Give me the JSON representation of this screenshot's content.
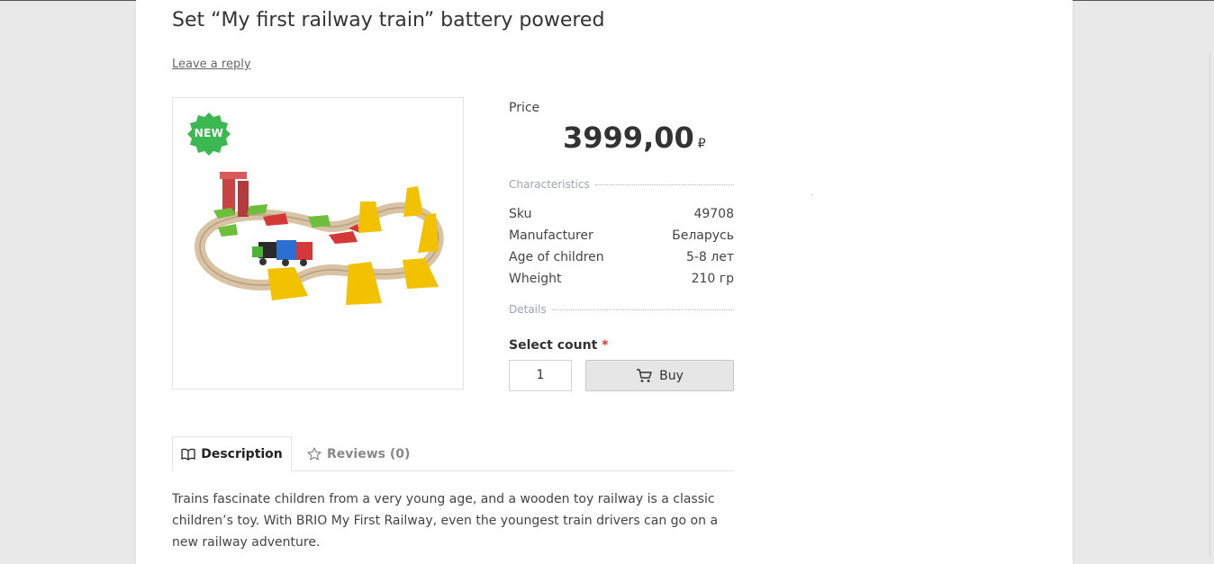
{
  "product": {
    "title": "Set “My first railway train” battery powered",
    "leave_reply": "Leave a reply",
    "badge": "NEW"
  },
  "price": {
    "label": "Price",
    "value": "3999,00",
    "currency": "₽"
  },
  "characteristics": {
    "heading": "Characteristics",
    "rows": [
      {
        "name": "Sku",
        "value": "49708"
      },
      {
        "name": "Manufacturer",
        "value": "Беларусь"
      },
      {
        "name": "Age of children",
        "value": "5-8 лет"
      },
      {
        "name": "Wheight",
        "value": "210 гр"
      }
    ],
    "details_heading": "Details"
  },
  "purchase": {
    "count_label": "Select count",
    "required_mark": "*",
    "quantity": "1",
    "buy_label": "Buy"
  },
  "tabs": [
    {
      "label": "Description",
      "icon": "book-icon",
      "active": true
    },
    {
      "label": "Reviews (0)",
      "icon": "star-icon",
      "active": false
    }
  ],
  "description": "Trains fascinate children from a very young age, and a wooden toy railway is a classic children’s toy. With BRIO My First Railway, even the youngest train drivers can go on a new railway adventure.",
  "colors": {
    "badge": "#3cb853",
    "button_bg": "#e6e6e6",
    "required": "#dd3333"
  }
}
